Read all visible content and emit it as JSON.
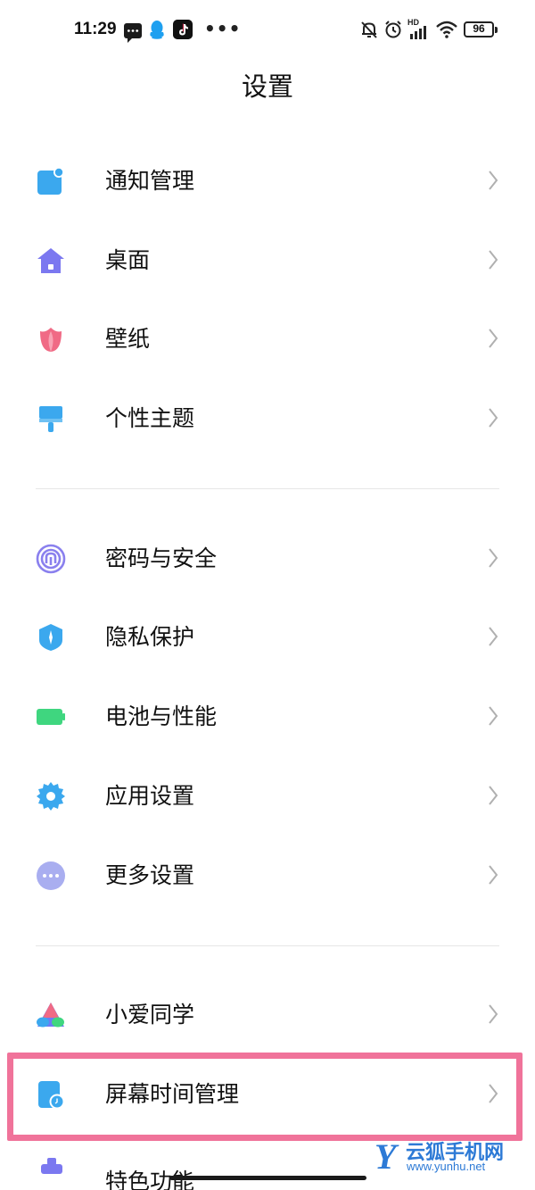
{
  "status_bar": {
    "time": "11:29",
    "more": "•••",
    "network_badge": "HD",
    "battery": "96",
    "icons": [
      "message-icon",
      "qq-icon",
      "tiktok-icon",
      "mute-bell-icon",
      "alarm-icon",
      "signal-icon",
      "wifi-icon",
      "battery-icon"
    ]
  },
  "header": {
    "title": "设置"
  },
  "groups": [
    {
      "items": [
        {
          "label": "通知管理",
          "icon": "notification-icon",
          "color": "#3ba8ee"
        },
        {
          "label": "桌面",
          "icon": "home-icon",
          "color": "#7b78f0"
        },
        {
          "label": "壁纸",
          "icon": "tulip-icon",
          "color": "#f06a85"
        },
        {
          "label": "个性主题",
          "icon": "paintbrush-icon",
          "color": "#3ba8ee"
        }
      ]
    },
    {
      "items": [
        {
          "label": "密码与安全",
          "icon": "fingerprint-icon",
          "color": "#8a80ee"
        },
        {
          "label": "隐私保护",
          "icon": "shield-icon",
          "color": "#3ba8ee"
        },
        {
          "label": "电池与性能",
          "icon": "battery-icon",
          "color": "#3fd67f"
        },
        {
          "label": "应用设置",
          "icon": "gear-icon",
          "color": "#3ba8ee"
        },
        {
          "label": "更多设置",
          "icon": "more-icon",
          "color": "#a9aef0"
        }
      ]
    },
    {
      "items": [
        {
          "label": "小爱同学",
          "icon": "xiaoai-icon",
          "color": "#6a7cf5"
        },
        {
          "label": "屏幕时间管理",
          "icon": "screen-time-icon",
          "color": "#3ba8ee",
          "highlighted": true
        }
      ]
    }
  ],
  "partial_item": {
    "label": "特色功能"
  },
  "highlight_color": "#f0739a",
  "watermark": {
    "text": "云狐手机网",
    "url": "www.yunhu.net"
  }
}
